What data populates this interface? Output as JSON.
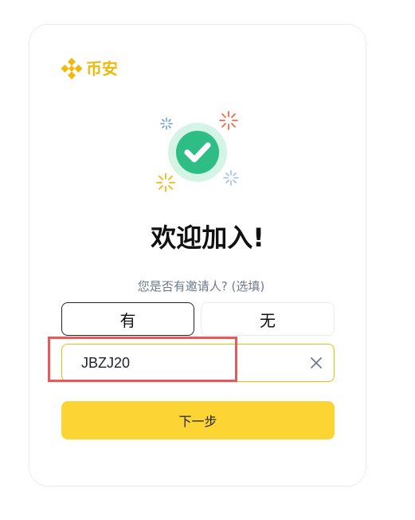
{
  "brand": {
    "name": "币安",
    "icon": "binance-logo-icon",
    "color": "#F0B90B"
  },
  "illustration": {
    "icon": "success-check-icon",
    "accent": "#2EBD85"
  },
  "title": "欢迎加入!",
  "referral": {
    "question": "您是否有邀请人?  (选填)",
    "yes_label": "有",
    "no_label": "无",
    "code_value": "JBZJ20",
    "clear_icon": "close-icon"
  },
  "next_button": {
    "label": "下一步",
    "color": "#FCD535"
  },
  "annotation": {
    "color": "#e8595a"
  }
}
